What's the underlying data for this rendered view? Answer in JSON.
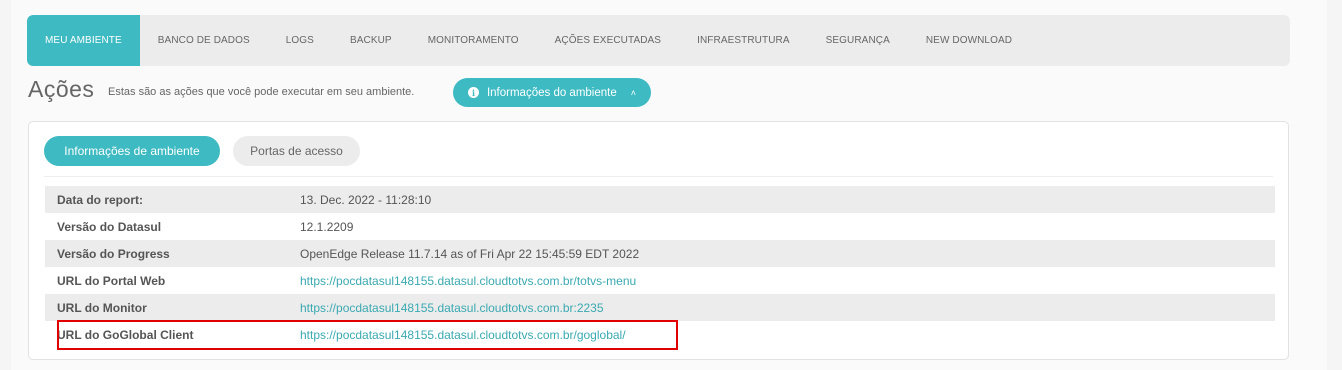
{
  "nav": {
    "items": [
      {
        "label": "MEU AMBIENTE",
        "active": true
      },
      {
        "label": "BANCO DE DADOS",
        "active": false
      },
      {
        "label": "LOGS",
        "active": false
      },
      {
        "label": "BACKUP",
        "active": false
      },
      {
        "label": "MONITORAMENTO",
        "active": false
      },
      {
        "label": "AÇÕES EXECUTADAS",
        "active": false
      },
      {
        "label": "INFRAESTRUTURA",
        "active": false
      },
      {
        "label": "SEGURANÇA",
        "active": false
      },
      {
        "label": "NEW DOWNLOAD",
        "active": false
      }
    ]
  },
  "header": {
    "title": "Ações",
    "subtitle": "Estas são as ações que você pode executar em seu ambiente.",
    "env_button_label": "Informações do ambiente",
    "env_button_icon": "info-icon",
    "env_button_chevron": "chevron-up-icon"
  },
  "panel": {
    "tabs": [
      {
        "label": "Informações de ambiente",
        "active": true
      },
      {
        "label": "Portas de acesso",
        "active": false
      }
    ],
    "rows": [
      {
        "key": "Data do report:",
        "value": "13. Dec. 2022 - 11:28:10",
        "link": false
      },
      {
        "key": "Versão do Datasul",
        "value": "12.1.2209",
        "link": false
      },
      {
        "key": "Versão do Progress",
        "value": "OpenEdge Release 11.7.14 as of Fri Apr 22 15:45:59 EDT 2022",
        "link": false
      },
      {
        "key": "URL do Portal Web",
        "value": "https://pocdatasul148155.datasul.cloudtotvs.com.br/totvs-menu",
        "link": true
      },
      {
        "key": "URL do Monitor",
        "value": "https://pocdatasul148155.datasul.cloudtotvs.com.br:2235",
        "link": true
      },
      {
        "key": "URL do GoGlobal Client",
        "value": "https://pocdatasul148155.datasul.cloudtotvs.com.br/goglobal/",
        "link": true
      }
    ]
  },
  "colors": {
    "accent": "#3dbac2",
    "link": "#3aa9b1",
    "highlight": "#e00000"
  }
}
